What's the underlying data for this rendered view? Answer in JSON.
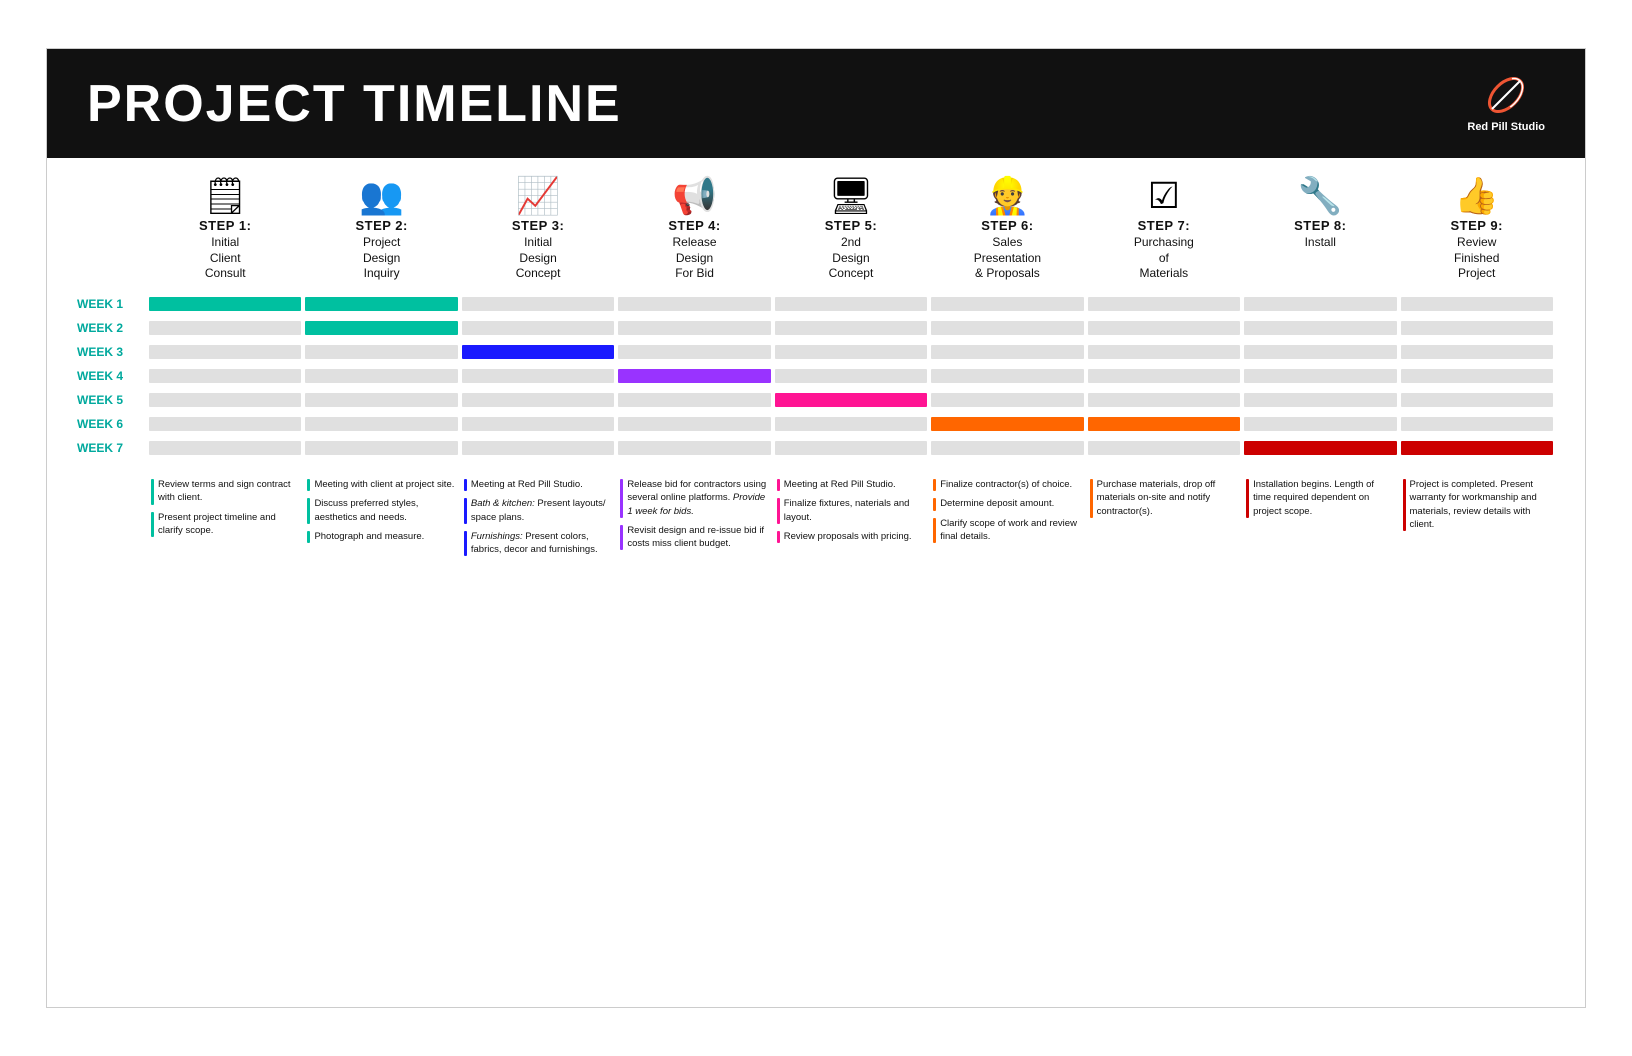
{
  "header": {
    "title": "PROJECT TIMELINE",
    "logo_text": "Red Pill Studio"
  },
  "steps": [
    {
      "id": "step1",
      "number": "STEP 1:",
      "icon": "📋",
      "title": "Initial\nClient\nConsult"
    },
    {
      "id": "step2",
      "number": "STEP 2:",
      "icon": "👥",
      "title": "Project\nDesign\nInquiry"
    },
    {
      "id": "step3",
      "number": "STEP 3:",
      "icon": "📈",
      "title": "Initial\nDesign\nConcept"
    },
    {
      "id": "step4",
      "number": "STEP 4:",
      "icon": "📣",
      "title": "Release\nDesign\nFor Bid"
    },
    {
      "id": "step5",
      "number": "STEP 5:",
      "icon": "🖥",
      "title": "2nd\nDesign\nConcept"
    },
    {
      "id": "step6",
      "number": "STEP 6:",
      "icon": "👷",
      "title": "Sales\nPresentation\n& Proposals"
    },
    {
      "id": "step7",
      "number": "STEP 7:",
      "icon": "📋",
      "title": "Purchasing\nof\nMaterials"
    },
    {
      "id": "step8",
      "number": "STEP 8:",
      "icon": "🔧",
      "title": "Install"
    },
    {
      "id": "step9",
      "number": "STEP 9:",
      "icon": "👍",
      "title": "Review\nFinished\nProject"
    }
  ],
  "weeks": [
    "WEEK 1",
    "WEEK 2",
    "WEEK 3",
    "WEEK 4",
    "WEEK 5",
    "WEEK 6",
    "WEEK 7"
  ],
  "gantt": {
    "week1": {
      "label": "WEEK 1",
      "active": [
        0,
        1
      ],
      "color": "#00c0a0"
    },
    "week2": {
      "label": "WEEK 2",
      "active": [
        1
      ],
      "color": "#00c0a0"
    },
    "week3": {
      "label": "WEEK 3",
      "active": [
        2
      ],
      "color": "#1a1aff"
    },
    "week4": {
      "label": "WEEK 4",
      "active": [
        3
      ],
      "color": "#9933ff"
    },
    "week5": {
      "label": "WEEK 5",
      "active": [
        4
      ],
      "color": "#ff1493"
    },
    "week6": {
      "label": "WEEK 6",
      "active": [
        5
      ],
      "color": "#ff6600"
    },
    "week7": {
      "label": "WEEK 7",
      "active": [
        7,
        8
      ],
      "color": "#cc0000"
    }
  },
  "notes": [
    {
      "step": 1,
      "items": [
        {
          "color": "#00c0a0",
          "text": "Review terms and sign contract with client."
        },
        {
          "color": "#00c0a0",
          "text": "Present project timeline and clarify scope."
        }
      ]
    },
    {
      "step": 2,
      "items": [
        {
          "color": "#00c0a0",
          "text": "Meeting with client at project site."
        },
        {
          "color": "#00c0a0",
          "text": "Discuss preferred styles, aesthetics and needs."
        },
        {
          "color": "#00c0a0",
          "text": "Photograph and measure."
        }
      ]
    },
    {
      "step": 3,
      "items": [
        {
          "color": "#1a1aff",
          "text": "Meeting at Red Pill Studio."
        },
        {
          "color": "#1a1aff",
          "text": "Bath & kitchen: Present layouts/ space plans."
        },
        {
          "color": "#1a1aff",
          "text": "Furnishings: Present colors, fabrics, decor and furnishings."
        }
      ]
    },
    {
      "step": 4,
      "items": [
        {
          "color": "#9933ff",
          "text": "Release bid for contractors using several online platforms. Provide 1 week for bids."
        },
        {
          "color": "#9933ff",
          "text": "Revisit design and re-issue bid if costs miss client budget."
        }
      ]
    },
    {
      "step": 5,
      "items": [
        {
          "color": "#ff1493",
          "text": "Meeting at Red Pill Studio."
        },
        {
          "color": "#ff1493",
          "text": "Finalize fixtures, naterials and layout."
        },
        {
          "color": "#ff1493",
          "text": "Review proposals with pricing."
        }
      ]
    },
    {
      "step": 6,
      "items": [
        {
          "color": "#ff6600",
          "text": "Finalize contractor(s) of choice."
        },
        {
          "color": "#ff6600",
          "text": "Determine deposit amount."
        },
        {
          "color": "#ff6600",
          "text": "Clarify scope of work and review final details."
        }
      ]
    },
    {
      "step": 7,
      "items": [
        {
          "color": "#ff6600",
          "text": "Purchase materials, drop off materials on-site and notify contractor(s)."
        }
      ]
    },
    {
      "step": 8,
      "items": [
        {
          "color": "#cc0000",
          "text": "Installation begins. Length of time required dependent on project scope."
        }
      ]
    },
    {
      "step": 9,
      "items": [
        {
          "color": "#cc0000",
          "text": "Project is completed. Present warranty for workmanship and materials, review details with client."
        }
      ]
    }
  ]
}
